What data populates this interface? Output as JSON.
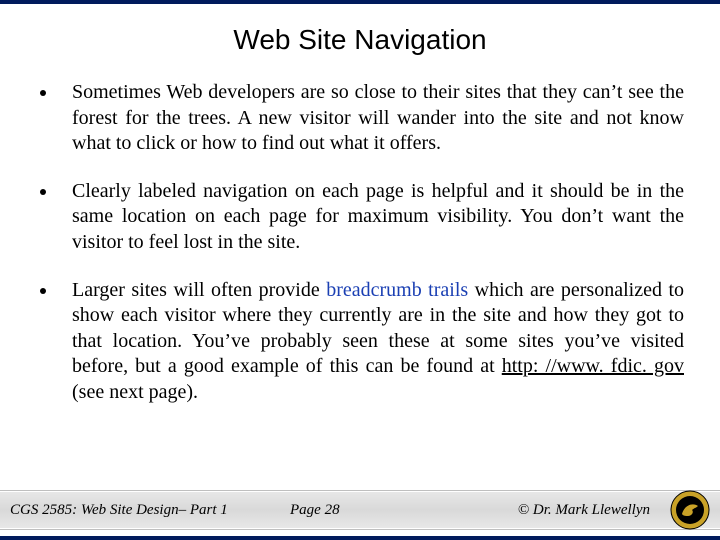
{
  "slide": {
    "title": "Web Site Navigation",
    "bullets": [
      {
        "text": "Sometimes Web developers are so close to their sites that they can’t  see the forest for the trees.  A new visitor will wander into the site and not know what to click or how to find out what it offers."
      },
      {
        "text": "Clearly labeled navigation on each page is helpful and it should be in the same location on each page for maximum visibility.  You don’t want the visitor to feel lost in the site."
      },
      {
        "pre": "Larger sites will often provide ",
        "keyword": "breadcrumb trails",
        "mid": " which are personalized to show each visitor where they currently are in the site and how they got to that location.  You’ve probably seen these at some sites you’ve visited before, but a good example of this can be found at ",
        "url": "http: //www. fdic. gov",
        "post": " (see next page)."
      }
    ],
    "footer": {
      "course": "CGS 2585: Web Site Design– Part 1",
      "page_label": "Page 28",
      "copyright": "© Dr. Mark Llewellyn"
    },
    "logo_name": "ucf-pegasus-logo"
  }
}
